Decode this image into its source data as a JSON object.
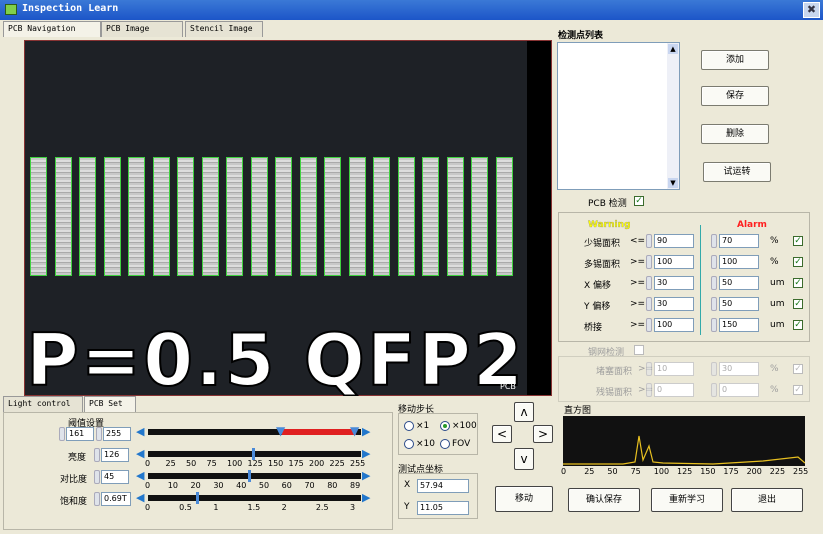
{
  "window": {
    "title": "Inspection Learn",
    "close": "✖"
  },
  "tabs": [
    "PCB Navigation",
    "PCB Image",
    "Stencil Image"
  ],
  "image": {
    "pcb_text": "P=0.5  QFP2",
    "pad_count": 20,
    "pcb_overlay": "PCB"
  },
  "points": {
    "label": "检测点列表",
    "buttons": {
      "add": "添加",
      "save": "保存",
      "delete": "删除",
      "test": "试运转"
    },
    "pcb_check": "PCB 检测",
    "pcb_check_on": true
  },
  "thresholds": {
    "warning": "Warning",
    "alarm": "Alarm",
    "warning_color": "#ffff00",
    "alarm_color": "#ff2020",
    "rows": [
      {
        "label": "少锡面积",
        "op": "<=",
        "warn": "90",
        "alarm": "70",
        "unit": "%"
      },
      {
        "label": "多锡面积",
        "op": ">=",
        "warn": "100",
        "alarm": "100",
        "unit": "%"
      },
      {
        "label": "X 偏移",
        "op": ">=",
        "warn": "30",
        "alarm": "50",
        "unit": "um"
      },
      {
        "label": "Y 偏移",
        "op": ">=",
        "warn": "30",
        "alarm": "50",
        "unit": "um"
      },
      {
        "label": "桥接",
        "op": ">=",
        "warn": "100",
        "alarm": "150",
        "unit": "um"
      }
    ]
  },
  "stencil": {
    "label": "钢网检测",
    "rows": [
      {
        "label": "堵塞面积",
        "op": ">=",
        "warn": "10",
        "alarm": "30",
        "unit": "%"
      },
      {
        "label": "残锡面积",
        "op": ">=",
        "warn": "0",
        "alarm": "0",
        "unit": "%"
      }
    ]
  },
  "bottom_tabs": [
    "Light control",
    "PCB Set"
  ],
  "pcb_set": {
    "threshold_label": "阈值设置",
    "thr_low": "161",
    "thr_high": "255",
    "brightness_label": "亮度",
    "brightness": "126",
    "contrast_label": "对比度",
    "contrast": "45",
    "saturation_label": "饱和度",
    "saturation": "0.69T",
    "scale_a": [
      "0",
      "25",
      "50",
      "75",
      "100",
      "125",
      "150",
      "175",
      "200",
      "225",
      "255"
    ],
    "scale_b": [
      "0",
      "10",
      "20",
      "30",
      "40",
      "50",
      "60",
      "70",
      "80",
      "89"
    ],
    "scale_c": [
      "0",
      "0.5",
      "1",
      "1.5",
      "2",
      "2.5",
      "3"
    ]
  },
  "move": {
    "step_label": "移动步长",
    "opts": [
      "×1",
      "×100",
      "×10",
      "FOV"
    ],
    "coord_label": "测试点坐标",
    "x_label": "X",
    "x": "57.94",
    "y_label": "Y",
    "y": "11.05",
    "move_btn": "移动",
    "up": "ʌ",
    "down": "v",
    "left": "<",
    "right": ">"
  },
  "histogram": {
    "label": "直方图",
    "ticks": [
      "0",
      "25",
      "50",
      "75",
      "100",
      "125",
      "150",
      "175",
      "200",
      "225",
      "255"
    ]
  },
  "actions": {
    "confirm": "确认保存",
    "relearn": "重新学习",
    "exit": "退出"
  }
}
